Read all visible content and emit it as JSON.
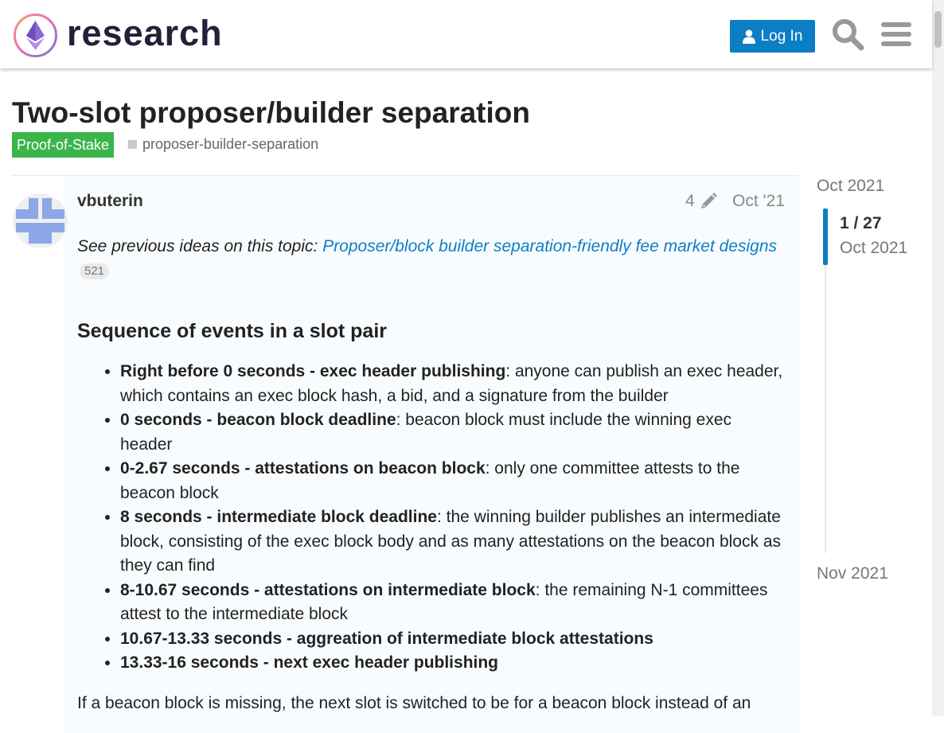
{
  "header": {
    "logo_text": "research",
    "login_label": "Log In"
  },
  "topic": {
    "title": "Two-slot proposer/builder separation",
    "category": "Proof-of-Stake",
    "tag": "proposer-builder-separation"
  },
  "post": {
    "username": "vbuterin",
    "edit_count": "4",
    "date": "Oct '21",
    "intro_text": "See previous ideas on this topic:",
    "intro_link": "Proposer/block builder separation-friendly fee market designs",
    "link_clicks": "521",
    "heading": "Sequence of events in a slot pair",
    "events": [
      {
        "bold": "Right before 0 seconds - exec header publishing",
        "text": ": anyone can publish an exec header, which contains an exec block hash, a bid, and a signature from the builder"
      },
      {
        "bold": "0 seconds - beacon block deadline",
        "text": ": beacon block must include the winning exec header"
      },
      {
        "bold": "0-2.67 seconds - attestations on beacon block",
        "text": ": only one committee attests to the beacon block"
      },
      {
        "bold": "8 seconds - intermediate block deadline",
        "text": ": the winning builder publishes an intermediate block, consisting of the exec block body and as many attestations on the beacon block as they can find"
      },
      {
        "bold": "8-10.67 seconds - attestations on intermediate block",
        "text": ": the remaining N-1 committees attest to the intermediate block"
      },
      {
        "bold": "10.67-13.33 seconds - aggreation of intermediate block attestations",
        "text": ""
      },
      {
        "bold": "13.33-16 seconds - next exec header publishing",
        "text": ""
      }
    ],
    "tail_text": "If a beacon block is missing, the next slot is switched to be for a beacon block instead of an"
  },
  "timeline": {
    "start": "Oct 2021",
    "position": "1 / 27",
    "current_date": "Oct 2021",
    "end": "Nov 2021"
  },
  "colors": {
    "accent": "#0c7ec4",
    "category": "#3ab54a",
    "post_bg": "#f9fcff"
  }
}
